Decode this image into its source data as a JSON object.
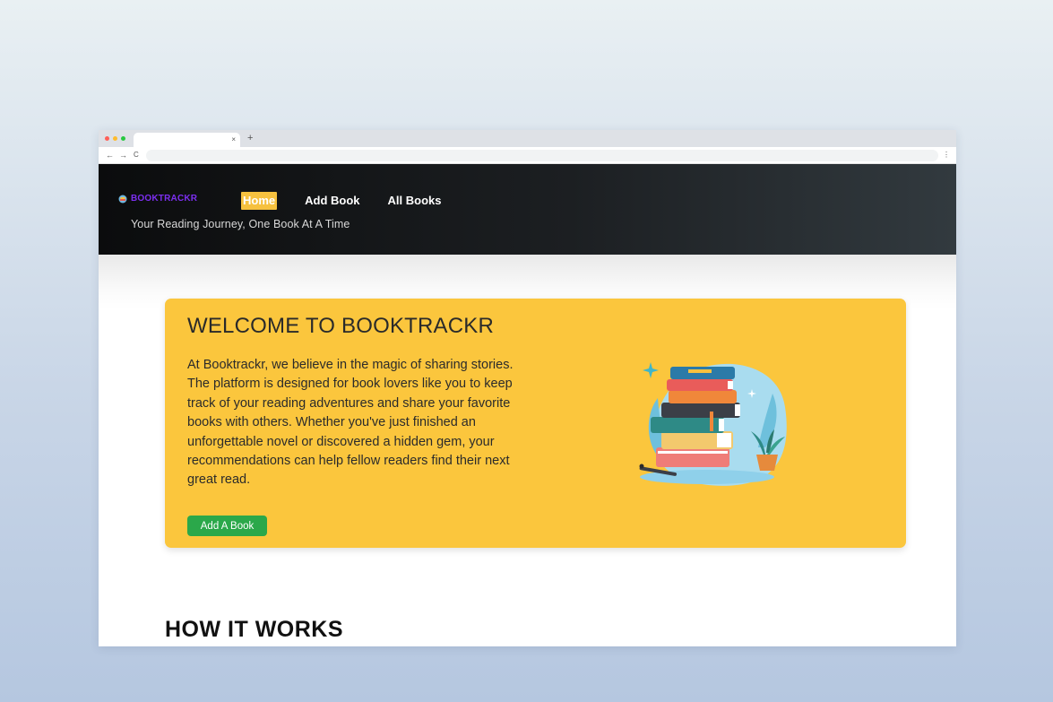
{
  "browser": {
    "tab_close": "×",
    "new_tab": "+",
    "back": "←",
    "forward": "→",
    "reload": "C",
    "menu": "⋮"
  },
  "header": {
    "logo_text": "BOOKTRACKR",
    "tagline": "Your Reading Journey, One Book At A Time",
    "nav": [
      {
        "label": "Home",
        "active": true
      },
      {
        "label": "Add Book",
        "active": false
      },
      {
        "label": "All Books",
        "active": false
      }
    ]
  },
  "hero": {
    "title": "WELCOME TO BOOKTRACKR",
    "text": "At Booktrackr, we believe in the magic of sharing stories. The platform is designed for book lovers like you to keep track of your reading adventures and share your favorite books with others. Whether you've just finished an unforgettable novel or discovered a hidden gem, your recommendations can help fellow readers find their next great read.",
    "button_label": "Add A Book",
    "illustration_icon": "book-stack-illustration"
  },
  "section": {
    "title": "HOW IT WORKS"
  },
  "colors": {
    "hero_bg": "#fbc63d",
    "nav_active_bg": "#f6c13f",
    "logo": "#7c2ff0",
    "button": "#2ba84a",
    "header_dark": "#0b0c0d"
  }
}
